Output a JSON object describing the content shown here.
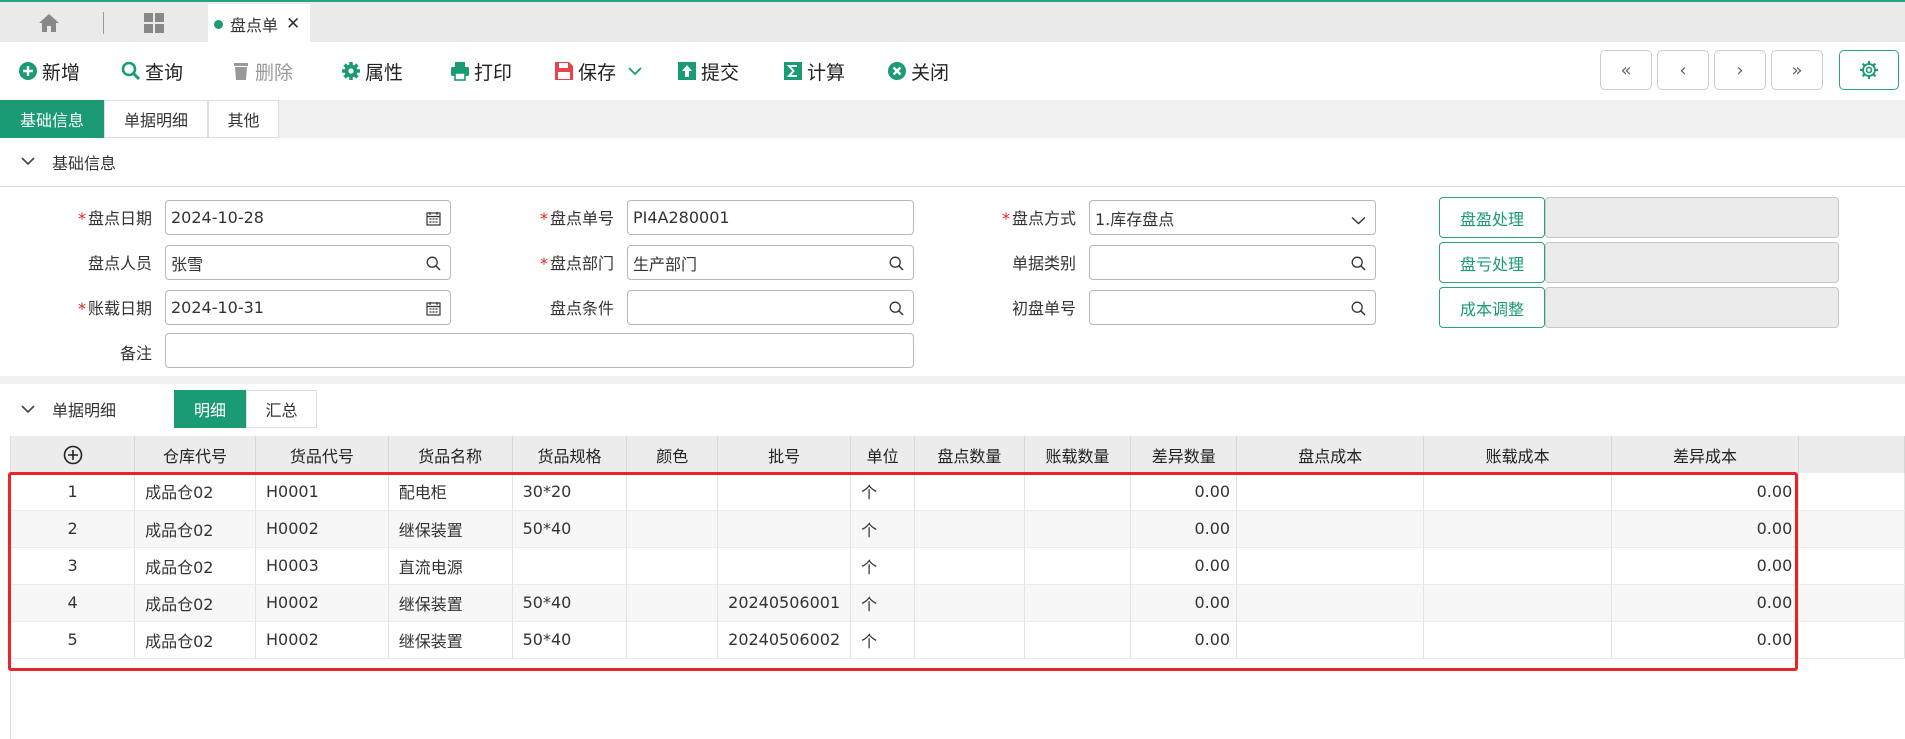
{
  "tabs": {
    "doc_tab_label": "盘点单",
    "close_glyph": "✕"
  },
  "toolbar": {
    "new_label": "新增",
    "query_label": "查询",
    "delete_label": "删除",
    "attr_label": "属性",
    "print_label": "打印",
    "save_label": "保存",
    "submit_label": "提交",
    "calc_label": "计算",
    "close_label": "关闭",
    "nav": [
      "«",
      "‹",
      "›",
      "»"
    ]
  },
  "section_tabs": [
    "基础信息",
    "单据明细",
    "其他"
  ],
  "basic": {
    "title": "基础信息",
    "count_date_label": "盘点日期",
    "count_date": "2024-10-28",
    "count_no_label": "盘点单号",
    "count_no": "PI4A280001",
    "count_method_label": "盘点方式",
    "count_method": "1.库存盘点",
    "counter_label": "盘点人员",
    "counter": "张雪",
    "dept_label": "盘点部门",
    "dept": "生产部门",
    "doc_type_label": "单据类别",
    "doc_type": "",
    "acct_date_label": "账载日期",
    "acct_date": "2024-10-31",
    "condition_label": "盘点条件",
    "condition": "",
    "initial_no_label": "初盘单号",
    "initial_no": "",
    "remark_label": "备注",
    "remark": "",
    "surplus_btn": "盘盈处理",
    "loss_btn": "盘亏处理",
    "cost_btn": "成本调整"
  },
  "detail": {
    "title": "单据明细",
    "subtabs": [
      "明细",
      "汇总"
    ],
    "add_glyph": "⊕",
    "columns": [
      "仓库代号",
      "货品代号",
      "货品名称",
      "货品规格",
      "颜色",
      "批号",
      "单位",
      "盘点数量",
      "账载数量",
      "差异数量",
      "盘点成本",
      "账载成本",
      "差异成本"
    ],
    "rows": [
      {
        "no": "1",
        "wh": "成品仓02",
        "code": "H0001",
        "name": "配电柜",
        "spec": "30*20",
        "color": "",
        "batch": "",
        "unit": "个",
        "count_qty": "",
        "book_qty": "",
        "diff_qty": "0.00",
        "count_cost": "",
        "book_cost": "",
        "diff_cost": "0.00"
      },
      {
        "no": "2",
        "wh": "成品仓02",
        "code": "H0002",
        "name": "继保装置",
        "spec": "50*40",
        "color": "",
        "batch": "",
        "unit": "个",
        "count_qty": "",
        "book_qty": "",
        "diff_qty": "0.00",
        "count_cost": "",
        "book_cost": "",
        "diff_cost": "0.00"
      },
      {
        "no": "3",
        "wh": "成品仓02",
        "code": "H0003",
        "name": "直流电源",
        "spec": "",
        "color": "",
        "batch": "",
        "unit": "个",
        "count_qty": "",
        "book_qty": "",
        "diff_qty": "0.00",
        "count_cost": "",
        "book_cost": "",
        "diff_cost": "0.00"
      },
      {
        "no": "4",
        "wh": "成品仓02",
        "code": "H0002",
        "name": "继保装置",
        "spec": "50*40",
        "color": "",
        "batch": "20240506001",
        "unit": "个",
        "count_qty": "",
        "book_qty": "",
        "diff_qty": "0.00",
        "count_cost": "",
        "book_cost": "",
        "diff_cost": "0.00"
      },
      {
        "no": "5",
        "wh": "成品仓02",
        "code": "H0002",
        "name": "继保装置",
        "spec": "50*40",
        "color": "",
        "batch": "20240506002",
        "unit": "个",
        "count_qty": "",
        "book_qty": "",
        "diff_qty": "0.00",
        "count_cost": "",
        "book_cost": "",
        "diff_cost": "0.00"
      }
    ]
  },
  "colors": {
    "accent": "#1a9b74",
    "highlight": "#e8242a"
  }
}
